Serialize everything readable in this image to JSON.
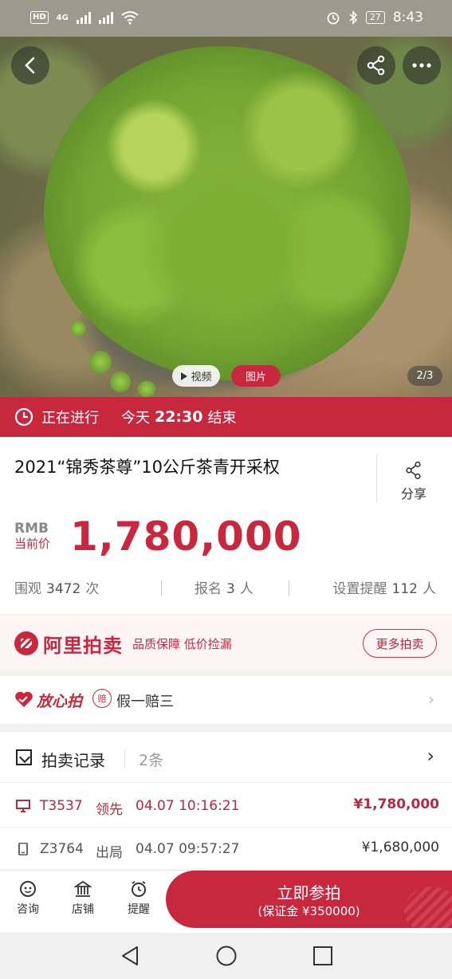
{
  "status_bar": {
    "network": "4G",
    "battery": "27",
    "time": "8:43"
  },
  "hero": {
    "video_label": "视频",
    "photo_label": "图片",
    "counter": "2/3"
  },
  "live": {
    "status": "正在进行",
    "day": "今天",
    "time": "22:30",
    "end": "结束"
  },
  "item": {
    "title": "2021“锦秀茶尊”10公斤茶青开采权",
    "share_label": "分享",
    "currency": "RMB",
    "price_label": "当前价",
    "price": "1,780,000"
  },
  "stats": {
    "views_label": "围观",
    "views_value": "3472",
    "views_unit": "次",
    "signup_label": "报名",
    "signup_value": "3",
    "signup_unit": "人",
    "remind_label": "设置提醒",
    "remind_value": "112",
    "remind_unit": "人"
  },
  "ali": {
    "name": "阿里拍卖",
    "tagline": "品质保障 低价捡漏",
    "more_button": "更多拍卖"
  },
  "guarantee": {
    "name": "放心拍",
    "badge": "赔",
    "text": "假一赔三"
  },
  "records": {
    "title": "拍卖记录",
    "count": "2条",
    "rows": [
      {
        "user": "T3537",
        "state": "领先",
        "time": "04.07 10:16:21",
        "amount": "¥1,780,000"
      },
      {
        "user": "Z3764",
        "state": "出局",
        "time": "04.07 09:57:27",
        "amount": "¥1,680,000"
      }
    ]
  },
  "bottom": {
    "consult": "咨询",
    "shop": "店铺",
    "remind": "提醒",
    "bid_label": "立即参拍",
    "deposit": "(保证金 ¥350000)"
  },
  "colors": {
    "accent": "#c8283e"
  }
}
